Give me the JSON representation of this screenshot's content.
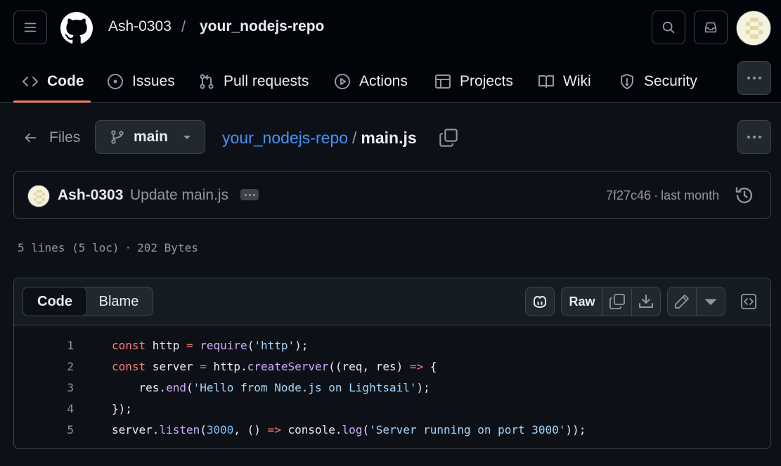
{
  "header": {
    "owner": "Ash-0303",
    "separator": "/",
    "repo": "your_nodejs-repo"
  },
  "tabs": [
    {
      "label": "Code",
      "icon": "code-icon",
      "active": true
    },
    {
      "label": "Issues",
      "icon": "issue-opened-icon"
    },
    {
      "label": "Pull requests",
      "icon": "git-pull-request-icon"
    },
    {
      "label": "Actions",
      "icon": "play-icon"
    },
    {
      "label": "Projects",
      "icon": "table-icon"
    },
    {
      "label": "Wiki",
      "icon": "book-icon"
    },
    {
      "label": "Security",
      "icon": "shield-icon"
    }
  ],
  "filenav": {
    "files_label": "Files",
    "branch": "main",
    "path_repo": "your_nodejs-repo",
    "path_sep": "/",
    "path_file": "main.js"
  },
  "commit": {
    "author": "Ash-0303",
    "message": "Update main.js",
    "sha": "7f27c46",
    "dot": "·",
    "time": "last month"
  },
  "fileinfo": {
    "lines": "5 lines (5 loc)",
    "dot": "·",
    "size": "202 Bytes"
  },
  "viewer": {
    "code_tab": "Code",
    "blame_tab": "Blame",
    "raw_label": "Raw"
  },
  "code_lines": [
    {
      "n": "1",
      "tokens": [
        [
          "kw",
          "const"
        ],
        [
          "",
          " http "
        ],
        [
          "op",
          "="
        ],
        [
          "",
          " "
        ],
        [
          "fn",
          "require"
        ],
        [
          "",
          "("
        ],
        [
          "str",
          "'http'"
        ],
        [
          "",
          ");"
        ]
      ]
    },
    {
      "n": "2",
      "tokens": [
        [
          "kw",
          "const"
        ],
        [
          "",
          " server "
        ],
        [
          "op",
          "="
        ],
        [
          "",
          " http."
        ],
        [
          "fn",
          "createServer"
        ],
        [
          "",
          "((req, res) "
        ],
        [
          "op",
          "=>"
        ],
        [
          "",
          " {"
        ]
      ]
    },
    {
      "n": "3",
      "tokens": [
        [
          "",
          "    res."
        ],
        [
          "fn",
          "end"
        ],
        [
          "",
          "("
        ],
        [
          "str",
          "'Hello from Node.js on Lightsail'"
        ],
        [
          "",
          ");"
        ]
      ]
    },
    {
      "n": "4",
      "tokens": [
        [
          "",
          "});"
        ]
      ]
    },
    {
      "n": "5",
      "tokens": [
        [
          "",
          "server."
        ],
        [
          "fn",
          "listen"
        ],
        [
          "",
          "("
        ],
        [
          "num",
          "3000"
        ],
        [
          "",
          ", () "
        ],
        [
          "op",
          "=>"
        ],
        [
          "",
          " console."
        ],
        [
          "fn",
          "log"
        ],
        [
          "",
          "("
        ],
        [
          "str",
          "'Server running on port 3000'"
        ],
        [
          "",
          "));"
        ]
      ]
    }
  ],
  "colors": {
    "accent_link": "#4493f8",
    "tab_underline": "#f78166",
    "keyword": "#ff7b72",
    "function": "#d2a8ff",
    "string": "#a5d6ff",
    "number": "#79c0ff"
  }
}
